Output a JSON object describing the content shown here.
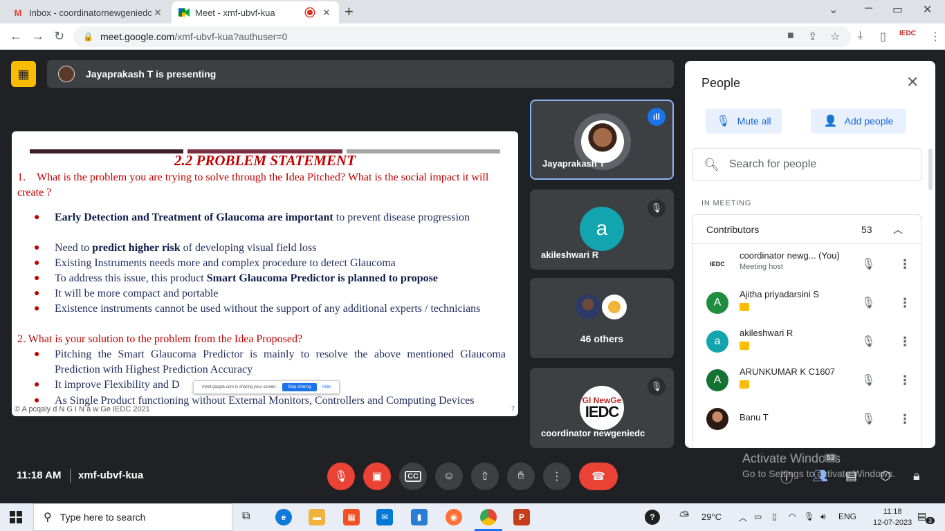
{
  "browser": {
    "tabs": [
      {
        "label": "Inbox - coordinatornewgeniedc@",
        "icon": "gmail-icon",
        "close": "✕"
      },
      {
        "label": "Meet - xmf-ubvf-kua",
        "icon": "meet-icon"
      }
    ],
    "new_tab": "+",
    "window": {
      "minimize": "⌄",
      "restore": "▭",
      "close": "✕"
    },
    "url_host": "meet.google.com",
    "url_path": "/xmf-ubvf-kua?authuser=0",
    "profile_text": "IEDC"
  },
  "meet": {
    "presenting_text": "Jayaprakash T is presenting",
    "slide": {
      "title": "2.2 PROBLEM STATEMENT",
      "q1_num": "1.",
      "q1": "What is the problem you are trying to solve through the Idea Pitched? What is the social impact it will create ?",
      "b1_bold": "Early Detection and Treatment of Glaucoma are important",
      "b1_rest": " to prevent disease progression",
      "b2_pre": "Need to ",
      "b2_bold": "predict higher risk",
      "b2_rest": " of developing visual field loss",
      "b3": "Existing Instruments needs more and complex procedure to detect Glaucoma",
      "b4_pre": "To address this issue, this product ",
      "b4_bold": "Smart Glaucoma Predictor is planned to propose",
      "b5": "It will be more  compact and portable",
      "b6": "Existence instruments  cannot  be used without the support of any additional experts / technicians",
      "q2_num": "2.",
      "q2": "What is your solution to the problem from the Idea Proposed?",
      "b7": "Pitching the Smart Glaucoma Predictor is mainly to resolve the above mentioned Glaucoma Prediction with Highest Prediction Accuracy",
      "b8": "It improve Flexibility and D",
      "b9": "As Single Product functioning without External Monitors, Controllers and Computing Devices",
      "footer": "© A pcqaly    d  N  G I  N  a  w Ge  IEDC 2021",
      "page_num": "7",
      "share_text": "meet.google.com is sharing your screen.",
      "share_stop": "Stop sharing",
      "share_hide": "Hide"
    },
    "tiles": [
      {
        "name": "Jayaprakash T"
      },
      {
        "name": "akileshwari R",
        "letter": "a"
      },
      {
        "label": "46 others"
      },
      {
        "name": "coordinator newgeniedc",
        "logo_top": "GI NewGe",
        "logo_main": "IEDC"
      }
    ]
  },
  "people": {
    "title": "People",
    "mute_all": "Mute all",
    "add_people": "Add people",
    "search_placeholder": "Search for people",
    "section": "IN MEETING",
    "group_label": "Contributors",
    "group_count": "53",
    "rows": [
      {
        "name": "coordinator newg...  (You)",
        "sub": "Meeting host",
        "avatar": "IEDC"
      },
      {
        "name": "Ajitha priyadarsini S",
        "avatar": "A",
        "color": "#1e8e3e"
      },
      {
        "name": "akileshwari R",
        "avatar": "a",
        "color": "#12a4af"
      },
      {
        "name": "ARUNKUMAR K C1607",
        "avatar": "A",
        "color": "#137333"
      },
      {
        "name": "Banu T",
        "avatar": ""
      }
    ]
  },
  "controls": {
    "time": "11:18 AM",
    "meeting_code": "xmf-ubvf-kua",
    "people_count": "53",
    "watermark_line1": "Activate Windows",
    "watermark_line2": "Go to Settings to activate Windows."
  },
  "taskbar": {
    "search_placeholder": "Type here to search",
    "weather": "29°C",
    "language": "ENG",
    "time": "11:18",
    "date": "12-07-2023",
    "notifications": "3"
  },
  "colors": {
    "meet_dark": "#202124",
    "tile_bg": "#3c4043",
    "accent_blue": "#1a73e8",
    "red": "#ea4335",
    "slide_red": "#c00000"
  }
}
